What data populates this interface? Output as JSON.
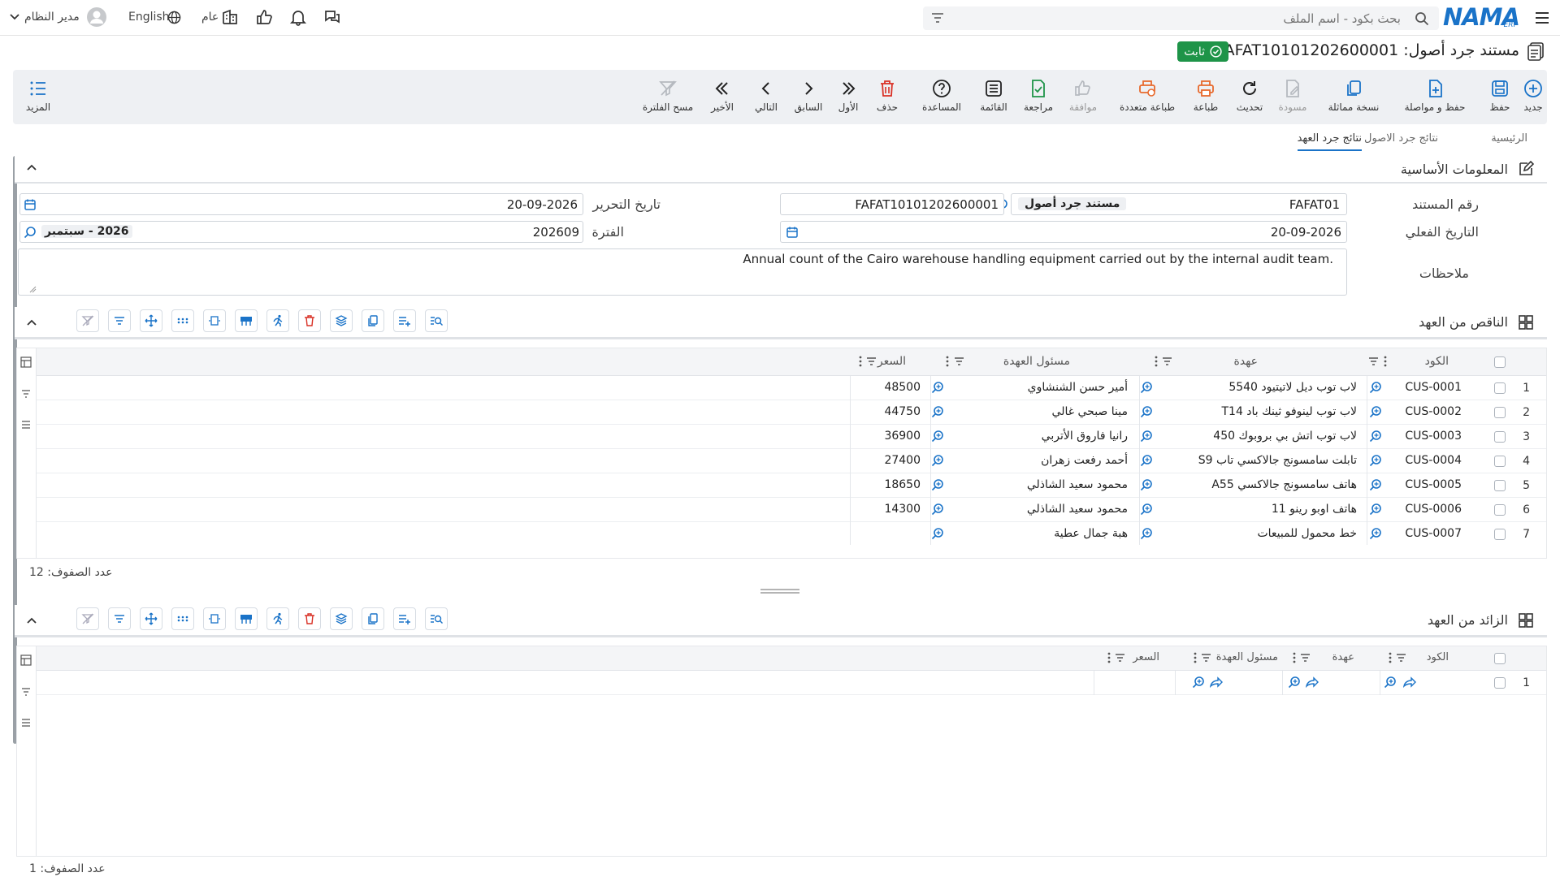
{
  "app": {
    "logo": "NAMA",
    "logo_sub": "ERP"
  },
  "header": {
    "search_placeholder": "بحث بكود - اسم الملف",
    "user": "مدير النظام",
    "language": "English",
    "scope": "عام"
  },
  "document": {
    "title": "مستند جرد أصول: FAFAT10101202600001",
    "status": "ثابت"
  },
  "toolbar": {
    "new": "جديد",
    "save": "حفظ",
    "save_continue": "حفظ و مواصلة",
    "copy": "نسخة مماثلة",
    "draft": "مسودة",
    "refresh": "تحديث",
    "print": "طباعة",
    "multi_print": "طباعة متعددة",
    "approve": "موافقة",
    "review": "مراجعة",
    "list": "القائمة",
    "help": "المساعدة",
    "delete": "حذف",
    "first": "الأول",
    "previous": "السابق",
    "next": "التالي",
    "last": "الأخير",
    "clear_filter": "مسح الفلترة",
    "more": "المزيد"
  },
  "tabs": {
    "main": "الرئيسية",
    "asset_results": "نتائج جرد الاصول",
    "custody_results": "نتائج جرد العهد"
  },
  "basic_info": {
    "title": "المعلومات الأساسية",
    "doc_number_label": "رقم المستند",
    "doc_number_prefix": "FAFAT01",
    "doc_type": "مستند جرد أصول",
    "doc_number": "FAFAT10101202600001",
    "edit_date_label": "تاريخ التحرير",
    "edit_date": "20-09-2026",
    "actual_date_label": "التاريخ الفعلي",
    "actual_date": "20-09-2026",
    "period_label": "الفترة",
    "period": "202609",
    "period_name": "2026 - سبتمبر",
    "notes_label": "ملاحظات",
    "notes": "Annual count of the Cairo warehouse handling equipment carried out by the internal audit team."
  },
  "shortage": {
    "title": "الناقص من العهد",
    "columns": {
      "code": "الكود",
      "custody": "عهدة",
      "responsible": "مسئول العهدة",
      "price": "السعر"
    },
    "rows": [
      {
        "n": "1",
        "code": "CUS-0001",
        "custody": "لاب توب ديل لاتيتيود 5540",
        "responsible": "أمير حسن الشنشاوي",
        "price": "48500"
      },
      {
        "n": "2",
        "code": "CUS-0002",
        "custody": "لاب توب لينوفو ثينك باد T14",
        "responsible": "مينا صبحي غالي",
        "price": "44750"
      },
      {
        "n": "3",
        "code": "CUS-0003",
        "custody": "لاب توب اتش بي بروبوك 450",
        "responsible": "رانيا فاروق الأتربي",
        "price": "36900"
      },
      {
        "n": "4",
        "code": "CUS-0004",
        "custody": "تابلت سامسونج جالاكسي تاب S9",
        "responsible": "أحمد رفعت زهران",
        "price": "27400"
      },
      {
        "n": "5",
        "code": "CUS-0005",
        "custody": "هاتف سامسونج جالاكسي A55",
        "responsible": "محمود سعيد الشاذلي",
        "price": "18650"
      },
      {
        "n": "6",
        "code": "CUS-0006",
        "custody": "هاتف اوبو رينو 11",
        "responsible": "محمود سعيد الشاذلي",
        "price": "14300"
      },
      {
        "n": "7",
        "code": "CUS-0007",
        "custody": "خط محمول للمبيعات",
        "responsible": "هبة جمال عطية",
        "price": ""
      }
    ],
    "row_count_label": "عدد الصفوف: 12"
  },
  "surplus": {
    "title": "الزائد من العهد",
    "columns": {
      "code": "الكود",
      "custody": "عهدة",
      "responsible": "مسئول العهدة",
      "price": "السعر"
    },
    "rows": [
      {
        "n": "1"
      }
    ],
    "row_count_label": "عدد الصفوف: 1"
  }
}
